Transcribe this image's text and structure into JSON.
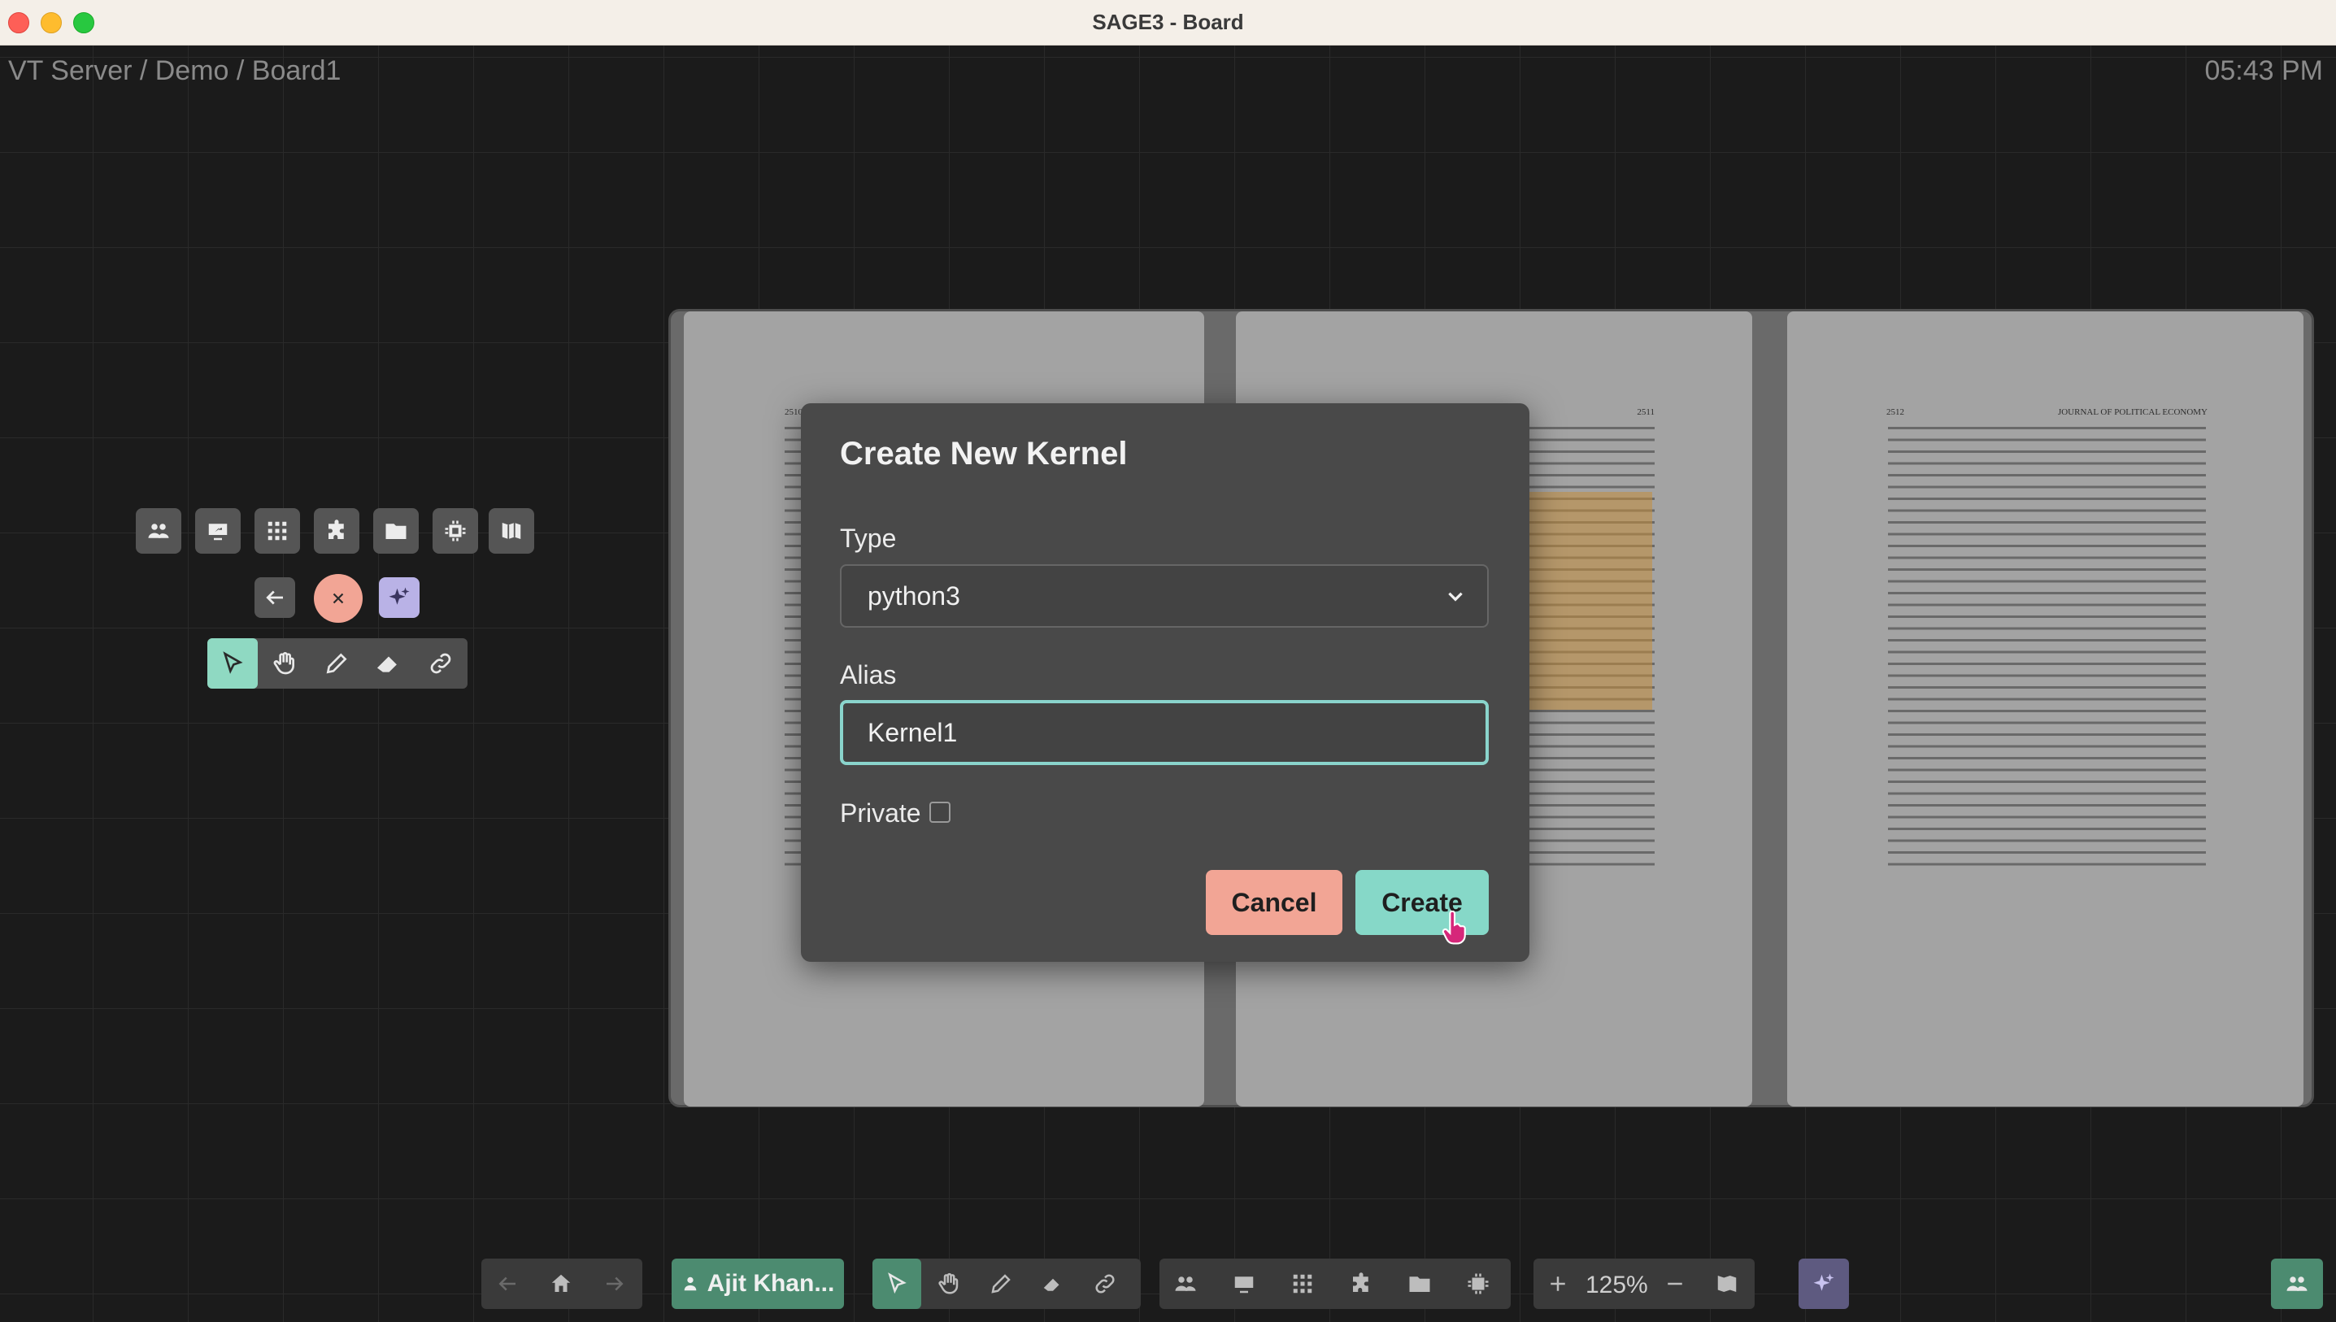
{
  "window": {
    "title": "SAGE3 - Board"
  },
  "board": {
    "breadcrumb": "VT Server / Demo / Board1",
    "clock": "05:43 PM"
  },
  "pdf": {
    "pages": [
      {
        "header_left": "2510",
        "header_right": ""
      },
      {
        "header_left": "",
        "header_right": "2511"
      },
      {
        "header_left": "2512",
        "header_right": "JOURNAL OF POLITICAL ECONOMY"
      }
    ]
  },
  "modal": {
    "title": "Create New Kernel",
    "type_label": "Type",
    "type_value": "python3",
    "alias_label": "Alias",
    "alias_value": "Kernel1",
    "private_label": "Private",
    "private_checked": false,
    "cancel_label": "Cancel",
    "create_label": "Create"
  },
  "toolbar_left": {
    "app_icons": [
      "users-icon",
      "screenshare-icon",
      "grid-icon",
      "puzzle-icon",
      "folder-icon",
      "chip-icon",
      "map-icon"
    ],
    "tools": [
      "pointer-icon",
      "hand-icon",
      "pen-icon",
      "eraser-icon",
      "link-icon"
    ]
  },
  "bottom_bar": {
    "user_label": "Ajit Khan...",
    "zoom_label": "125%"
  },
  "colors": {
    "accent_teal": "#86d8c8",
    "cancel_salmon": "#f2a595",
    "user_green": "#4c8b70",
    "ai_purple": "#b9b2e6",
    "close_red": "#f2a595"
  }
}
